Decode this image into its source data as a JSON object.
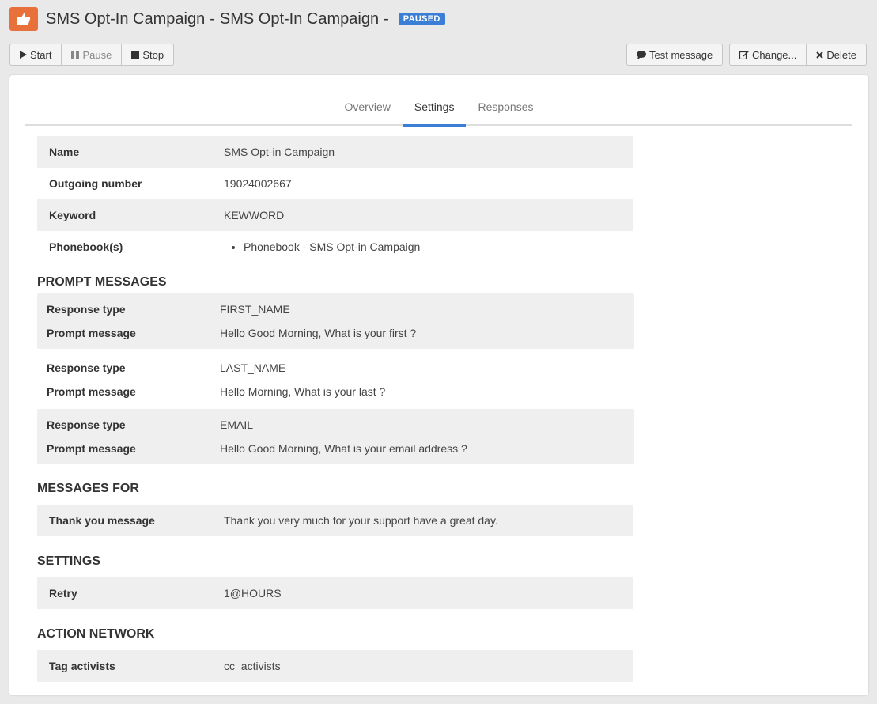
{
  "header": {
    "title": "SMS Opt-In Campaign",
    "subtitle": "SMS Opt-In Campaign",
    "separator": "-",
    "status_badge": "PAUSED",
    "logo_icon": "thumbs-up-icon",
    "logo_color": "#e8703a",
    "badge_color": "#3a7fd5"
  },
  "toolbar": {
    "start_label": "Start",
    "pause_label": "Pause",
    "stop_label": "Stop",
    "test_message_label": "Test message",
    "change_label": "Change...",
    "delete_label": "Delete"
  },
  "tabs": [
    {
      "label": "Overview",
      "active": false
    },
    {
      "label": "Settings",
      "active": true
    },
    {
      "label": "Responses",
      "active": false
    }
  ],
  "details": {
    "name_label": "Name",
    "name_value": "SMS Opt-in Campaign",
    "outgoing_label": "Outgoing number",
    "outgoing_value": "19024002667",
    "keyword_label": "Keyword",
    "keyword_value": "KEWWORD",
    "phonebooks_label": "Phonebook(s)",
    "phonebooks": [
      "Phonebook - SMS Opt-in Campaign"
    ]
  },
  "prompt_messages": {
    "heading": "PROMPT MESSAGES",
    "response_type_label": "Response type",
    "prompt_message_label": "Prompt message",
    "items": [
      {
        "response_type": "FIRST_NAME",
        "prompt": "Hello Good Morning, What is your first ?"
      },
      {
        "response_type": "LAST_NAME",
        "prompt": "Hello Morning, What is your last ?"
      },
      {
        "response_type": "EMAIL",
        "prompt": "Hello Good Morning, What is your email address ?"
      }
    ]
  },
  "messages_for": {
    "heading": "MESSAGES FOR",
    "thank_you_label": "Thank you message",
    "thank_you_value": "Thank you very much for your support have a great day."
  },
  "settings": {
    "heading": "SETTINGS",
    "retry_label": "Retry",
    "retry_value": "1@HOURS"
  },
  "action_network": {
    "heading": "ACTION NETWORK",
    "tag_label": "Tag activists",
    "tag_value": "cc_activists"
  }
}
